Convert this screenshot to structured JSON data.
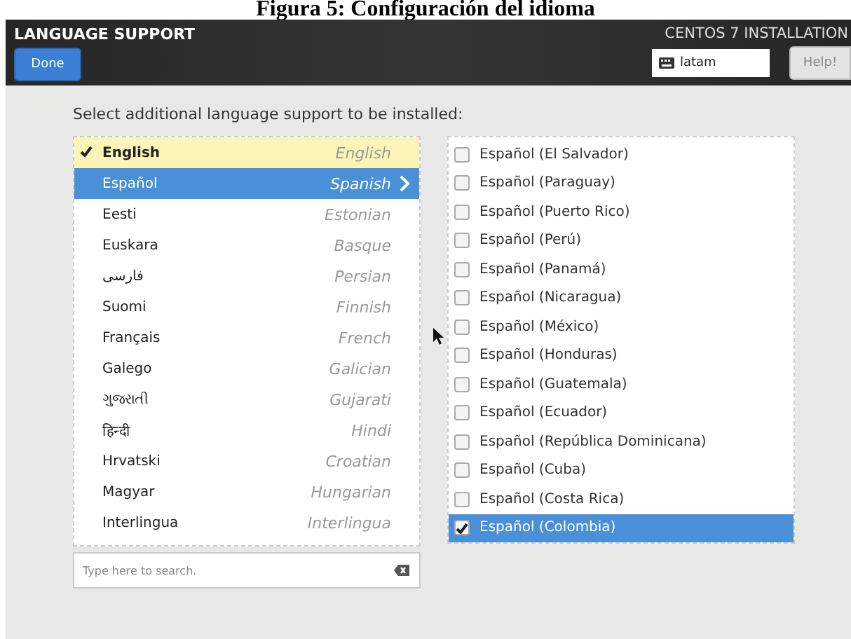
{
  "caption": "Figura 5: Configuración del idioma",
  "header": {
    "title": "LANGUAGE SUPPORT",
    "done_button": "Done",
    "product": "CENTOS 7 INSTALLATION",
    "keyboard": "latam",
    "help_button": "Help!"
  },
  "prompt": "Select additional language support to be installed:",
  "languages": [
    {
      "native": "English",
      "english": "English",
      "checked": true,
      "selected": false
    },
    {
      "native": "Español",
      "english": "Spanish",
      "checked": false,
      "selected": true
    },
    {
      "native": "Eesti",
      "english": "Estonian",
      "checked": false,
      "selected": false
    },
    {
      "native": "Euskara",
      "english": "Basque",
      "checked": false,
      "selected": false
    },
    {
      "native": "فارسی",
      "english": "Persian",
      "checked": false,
      "selected": false
    },
    {
      "native": "Suomi",
      "english": "Finnish",
      "checked": false,
      "selected": false
    },
    {
      "native": "Français",
      "english": "French",
      "checked": false,
      "selected": false
    },
    {
      "native": "Galego",
      "english": "Galician",
      "checked": false,
      "selected": false
    },
    {
      "native": "ગુજરાતી",
      "english": "Gujarati",
      "checked": false,
      "selected": false
    },
    {
      "native": "हिन्दी",
      "english": "Hindi",
      "checked": false,
      "selected": false
    },
    {
      "native": "Hrvatski",
      "english": "Croatian",
      "checked": false,
      "selected": false
    },
    {
      "native": "Magyar",
      "english": "Hungarian",
      "checked": false,
      "selected": false
    },
    {
      "native": "Interlingua",
      "english": "Interlingua",
      "checked": false,
      "selected": false
    }
  ],
  "search": {
    "placeholder": "Type here to search."
  },
  "locales": [
    {
      "label": "Español (El Salvador)",
      "checked": false,
      "selected": false
    },
    {
      "label": "Español (Paraguay)",
      "checked": false,
      "selected": false
    },
    {
      "label": "Español (Puerto Rico)",
      "checked": false,
      "selected": false
    },
    {
      "label": "Español (Perú)",
      "checked": false,
      "selected": false
    },
    {
      "label": "Español (Panamá)",
      "checked": false,
      "selected": false
    },
    {
      "label": "Español (Nicaragua)",
      "checked": false,
      "selected": false
    },
    {
      "label": "Español (México)",
      "checked": false,
      "selected": false
    },
    {
      "label": "Español (Honduras)",
      "checked": false,
      "selected": false
    },
    {
      "label": "Español (Guatemala)",
      "checked": false,
      "selected": false
    },
    {
      "label": "Español (Ecuador)",
      "checked": false,
      "selected": false
    },
    {
      "label": "Español (República Dominicana)",
      "checked": false,
      "selected": false
    },
    {
      "label": "Español (Cuba)",
      "checked": false,
      "selected": false
    },
    {
      "label": "Español (Costa Rica)",
      "checked": false,
      "selected": false
    },
    {
      "label": "Español (Colombia)",
      "checked": true,
      "selected": true
    }
  ]
}
